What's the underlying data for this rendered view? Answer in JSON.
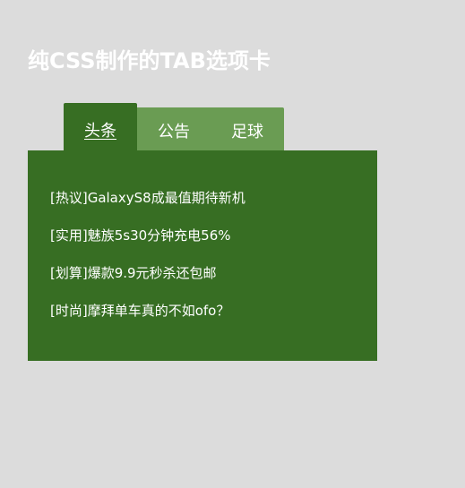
{
  "page": {
    "title": "纯CSS制作的TAB选项卡"
  },
  "tabs": [
    {
      "label": "头条",
      "active": true
    },
    {
      "label": "公告",
      "active": false
    },
    {
      "label": "足球",
      "active": false
    }
  ],
  "news": [
    "[热议]GalaxyS8成最值期待新机",
    "[实用]魅族5s30分钟充电56%",
    "[划算]爆款9.9元秒杀还包邮",
    "[时尚]摩拜单车真的不如ofo？"
  ],
  "colors": {
    "background": "#dcdcdc",
    "active_tab": "#376e23",
    "inactive_tab": "#6a9c53",
    "panel": "#376e23",
    "text": "#ffffff"
  }
}
